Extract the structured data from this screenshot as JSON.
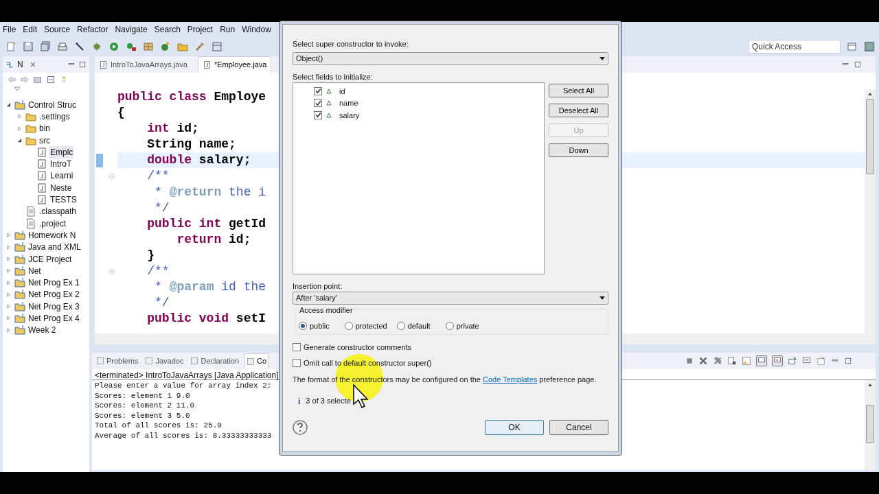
{
  "menu": [
    "File",
    "Edit",
    "Source",
    "Refactor",
    "Navigate",
    "Search",
    "Project",
    "Run",
    "Window"
  ],
  "quick_access": {
    "placeholder": "Quick Access"
  },
  "navigator": {
    "tab": "N",
    "close": "×",
    "tree": [
      {
        "label": "Control Struc",
        "kind": "project",
        "expanded": true,
        "selected": false,
        "children": [
          {
            "label": ".settings",
            "kind": "folder",
            "expanded": false,
            "selected": false
          },
          {
            "label": "bin",
            "kind": "folder",
            "expanded": false,
            "selected": false
          },
          {
            "label": "src",
            "kind": "folder",
            "expanded": true,
            "selected": false,
            "children": [
              {
                "label": "Emplc",
                "kind": "java",
                "selected": true
              },
              {
                "label": "IntroT",
                "kind": "java",
                "selected": false
              },
              {
                "label": "Learni",
                "kind": "java",
                "selected": false
              },
              {
                "label": "Neste",
                "kind": "java",
                "selected": false
              },
              {
                "label": "TESTS",
                "kind": "java",
                "selected": false
              }
            ]
          },
          {
            "label": ".classpath",
            "kind": "file",
            "selected": false
          },
          {
            "label": ".project",
            "kind": "file",
            "selected": false
          }
        ]
      },
      {
        "label": "Homework N",
        "kind": "project",
        "expanded": false,
        "selected": false
      },
      {
        "label": "Java and XML",
        "kind": "project",
        "expanded": false,
        "selected": false
      },
      {
        "label": "JCE Project",
        "kind": "project",
        "expanded": false,
        "selected": false
      },
      {
        "label": "Net",
        "kind": "project",
        "expanded": false,
        "selected": false
      },
      {
        "label": "Net Prog Ex 1",
        "kind": "project",
        "expanded": false,
        "selected": false
      },
      {
        "label": "Net Prog Ex 2",
        "kind": "project",
        "expanded": false,
        "selected": false
      },
      {
        "label": "Net Prog Ex 3",
        "kind": "project",
        "expanded": false,
        "selected": false
      },
      {
        "label": "Net Prog Ex 4",
        "kind": "project",
        "expanded": false,
        "selected": false
      },
      {
        "label": "Week 2",
        "kind": "project",
        "expanded": false,
        "selected": false
      }
    ]
  },
  "editor": {
    "tabs": [
      {
        "label": "IntroToJavaArrays.java",
        "selected": false
      },
      {
        "label": "*Employee.java",
        "selected": true
      }
    ],
    "lines": [
      {
        "current": false,
        "tokens": [
          {
            "kind": "keyword",
            "text": "public class "
          },
          {
            "kind": "plain",
            "text": "Employe"
          }
        ]
      },
      {
        "current": false,
        "tokens": [
          {
            "kind": "plain",
            "text": "{"
          }
        ]
      },
      {
        "current": false,
        "tokens": [
          {
            "kind": "keyword",
            "text": "    int"
          },
          {
            "kind": "plain",
            "text": " id;"
          }
        ]
      },
      {
        "current": false,
        "tokens": [
          {
            "kind": "plain",
            "text": "    String name;"
          }
        ]
      },
      {
        "current": true,
        "tokens": [
          {
            "kind": "keyword",
            "text": "    double"
          },
          {
            "kind": "plain",
            "text": " salary;"
          }
        ]
      },
      {
        "current": false,
        "tokens": [
          {
            "kind": "comment",
            "text": "    /**"
          }
        ]
      },
      {
        "current": false,
        "tokens": [
          {
            "kind": "comment",
            "text": "     * "
          },
          {
            "kind": "tag",
            "text": "@return"
          },
          {
            "kind": "comment",
            "text": " the i"
          }
        ]
      },
      {
        "current": false,
        "tokens": [
          {
            "kind": "comment",
            "text": "     */"
          }
        ]
      },
      {
        "current": false,
        "tokens": [
          {
            "kind": "keyword",
            "text": "    public int"
          },
          {
            "kind": "plain",
            "text": " getId"
          }
        ]
      },
      {
        "current": false,
        "tokens": [
          {
            "kind": "keyword",
            "text": "        return"
          },
          {
            "kind": "plain",
            "text": " id;"
          }
        ]
      },
      {
        "current": false,
        "tokens": [
          {
            "kind": "plain",
            "text": "    }"
          }
        ]
      },
      {
        "current": false,
        "tokens": [
          {
            "kind": "comment",
            "text": "    /**"
          }
        ]
      },
      {
        "current": false,
        "tokens": [
          {
            "kind": "comment",
            "text": "     * "
          },
          {
            "kind": "tag",
            "text": "@param"
          },
          {
            "kind": "comment",
            "text": " id the"
          }
        ]
      },
      {
        "current": false,
        "tokens": [
          {
            "kind": "comment",
            "text": "     */"
          }
        ]
      },
      {
        "current": false,
        "tokens": [
          {
            "kind": "keyword",
            "text": "    public void"
          },
          {
            "kind": "plain",
            "text": " setI"
          }
        ]
      }
    ]
  },
  "bottom": {
    "tabs": [
      {
        "label": "Problems",
        "selected": false
      },
      {
        "label": "Javadoc",
        "selected": false
      },
      {
        "label": "Declaration",
        "selected": false
      },
      {
        "label": "Co",
        "selected": true
      }
    ],
    "console_header": "<terminated> IntroToJavaArrays [Java Application]",
    "console_lines": [
      "Please enter a value for array index 2:",
      "Scores: element 1 9.0",
      "Scores: element 2 11.0",
      "Scores: element 3 5.0",
      "Total of all scores is: 25.0",
      "Average of all scores is: 8.33333333333"
    ]
  },
  "dialog": {
    "super_label": "Select super constructor to invoke:",
    "super_value": "Object()",
    "fields_label": "Select fields to initialize:",
    "fields": [
      {
        "name": "id",
        "checked": true
      },
      {
        "name": "name",
        "checked": true
      },
      {
        "name": "salary",
        "checked": true
      }
    ],
    "side_buttons": [
      {
        "label": "Select All",
        "disabled": false
      },
      {
        "label": "Deselect All",
        "disabled": false
      },
      {
        "label": "Up",
        "disabled": true
      },
      {
        "label": "Down",
        "disabled": false
      }
    ],
    "insertion_label": "Insertion point:",
    "insertion_value": "After 'salary'",
    "access_label": "Access modifier",
    "access": [
      {
        "label": "public",
        "selected": true
      },
      {
        "label": "protected",
        "selected": false
      },
      {
        "label": "default",
        "selected": false
      },
      {
        "label": "private",
        "selected": false
      }
    ],
    "options": [
      {
        "label": "Generate constructor comments",
        "checked": false
      },
      {
        "label": "Omit call to default constructor super()",
        "checked": false
      }
    ],
    "note": "The format of the constructors may be configured on the",
    "note_link": "Code Templates",
    "note_end": "preference page.",
    "info_icon": "i",
    "info": "3 of 3 selecte",
    "ok": "OK",
    "cancel": "Cancel"
  }
}
